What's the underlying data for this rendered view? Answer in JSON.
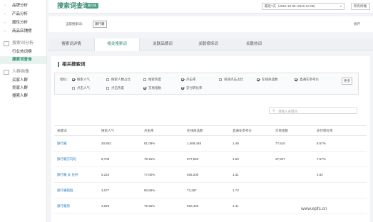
{
  "sidebar": {
    "items": [
      {
        "label": "品牌分析"
      },
      {
        "label": "产品分析"
      },
      {
        "label": "属性分析"
      },
      {
        "label": "商品店铺榜"
      }
    ],
    "group1": {
      "label": "搜索词分析",
      "items": [
        {
          "label": "行业热词榜"
        },
        {
          "label": "搜索词查询"
        }
      ]
    },
    "group2": {
      "label": "人群画像",
      "items": [
        {
          "label": "买家人群"
        },
        {
          "label": "卖家人群"
        },
        {
          "label": "搜索人群"
        }
      ]
    }
  },
  "header": {
    "title": "搜索词查询",
    "badge": "番打模",
    "date_range": "最近7天（2016-10-05~2016-10-08）",
    "device": "所有终端"
  },
  "crumb": {
    "label": "当前搜索词：",
    "chip": "旗行箱",
    "more": "展开"
  },
  "tabs": [
    "搜索词详情",
    "相关搜索词",
    "关联品牌词",
    "关联修饰词",
    "关联热词"
  ],
  "panel": {
    "title": "相关搜索词",
    "metric_label": "指标：",
    "more_btn": "更多",
    "search_placeholder": "请输入关键词"
  },
  "metrics": [
    {
      "label": "搜索人气",
      "checked": true
    },
    {
      "label": "搜索人数占比",
      "checked": false
    },
    {
      "label": "搜索热度",
      "checked": false
    },
    {
      "label": "点击率",
      "checked": true
    },
    {
      "label": "商城点击占比",
      "checked": false
    },
    {
      "label": "在线商品数",
      "checked": true
    },
    {
      "label": "直通车参考价",
      "checked": true
    },
    {
      "label": "点击人气",
      "checked": false
    },
    {
      "label": "点击热度",
      "checked": false
    },
    {
      "label": "交易指数",
      "checked": true
    },
    {
      "label": "支付转化率",
      "checked": true
    }
  ],
  "table": {
    "headers": [
      "关键词",
      "搜索人气",
      "点击率",
      "在线商品数",
      "直通车参考价",
      "交易指数",
      "支付转化率"
    ],
    "rows": [
      [
        "旗行箱",
        "20,803",
        "81.09%",
        "1,069,448",
        "1.49",
        "77,610",
        "8.57%"
      ],
      [
        "旗行箱万向轮",
        "8,706",
        "79.15%",
        "977,560",
        "1.60",
        "37,607",
        "7.57%"
      ],
      [
        "旗行箱 女 拉杆",
        "5,210",
        "77.00%",
        "926,200",
        "1.31",
        "",
        "4.82"
      ],
      [
        "旗行箱铝框",
        "3,077",
        "90.59%",
        "73,287",
        "1.73",
        "",
        ""
      ],
      [
        "旗行箱男",
        "3,029",
        "76.25%",
        "820,430",
        "1.41",
        "",
        ""
      ]
    ]
  },
  "watermark": "www.epfc.cn"
}
